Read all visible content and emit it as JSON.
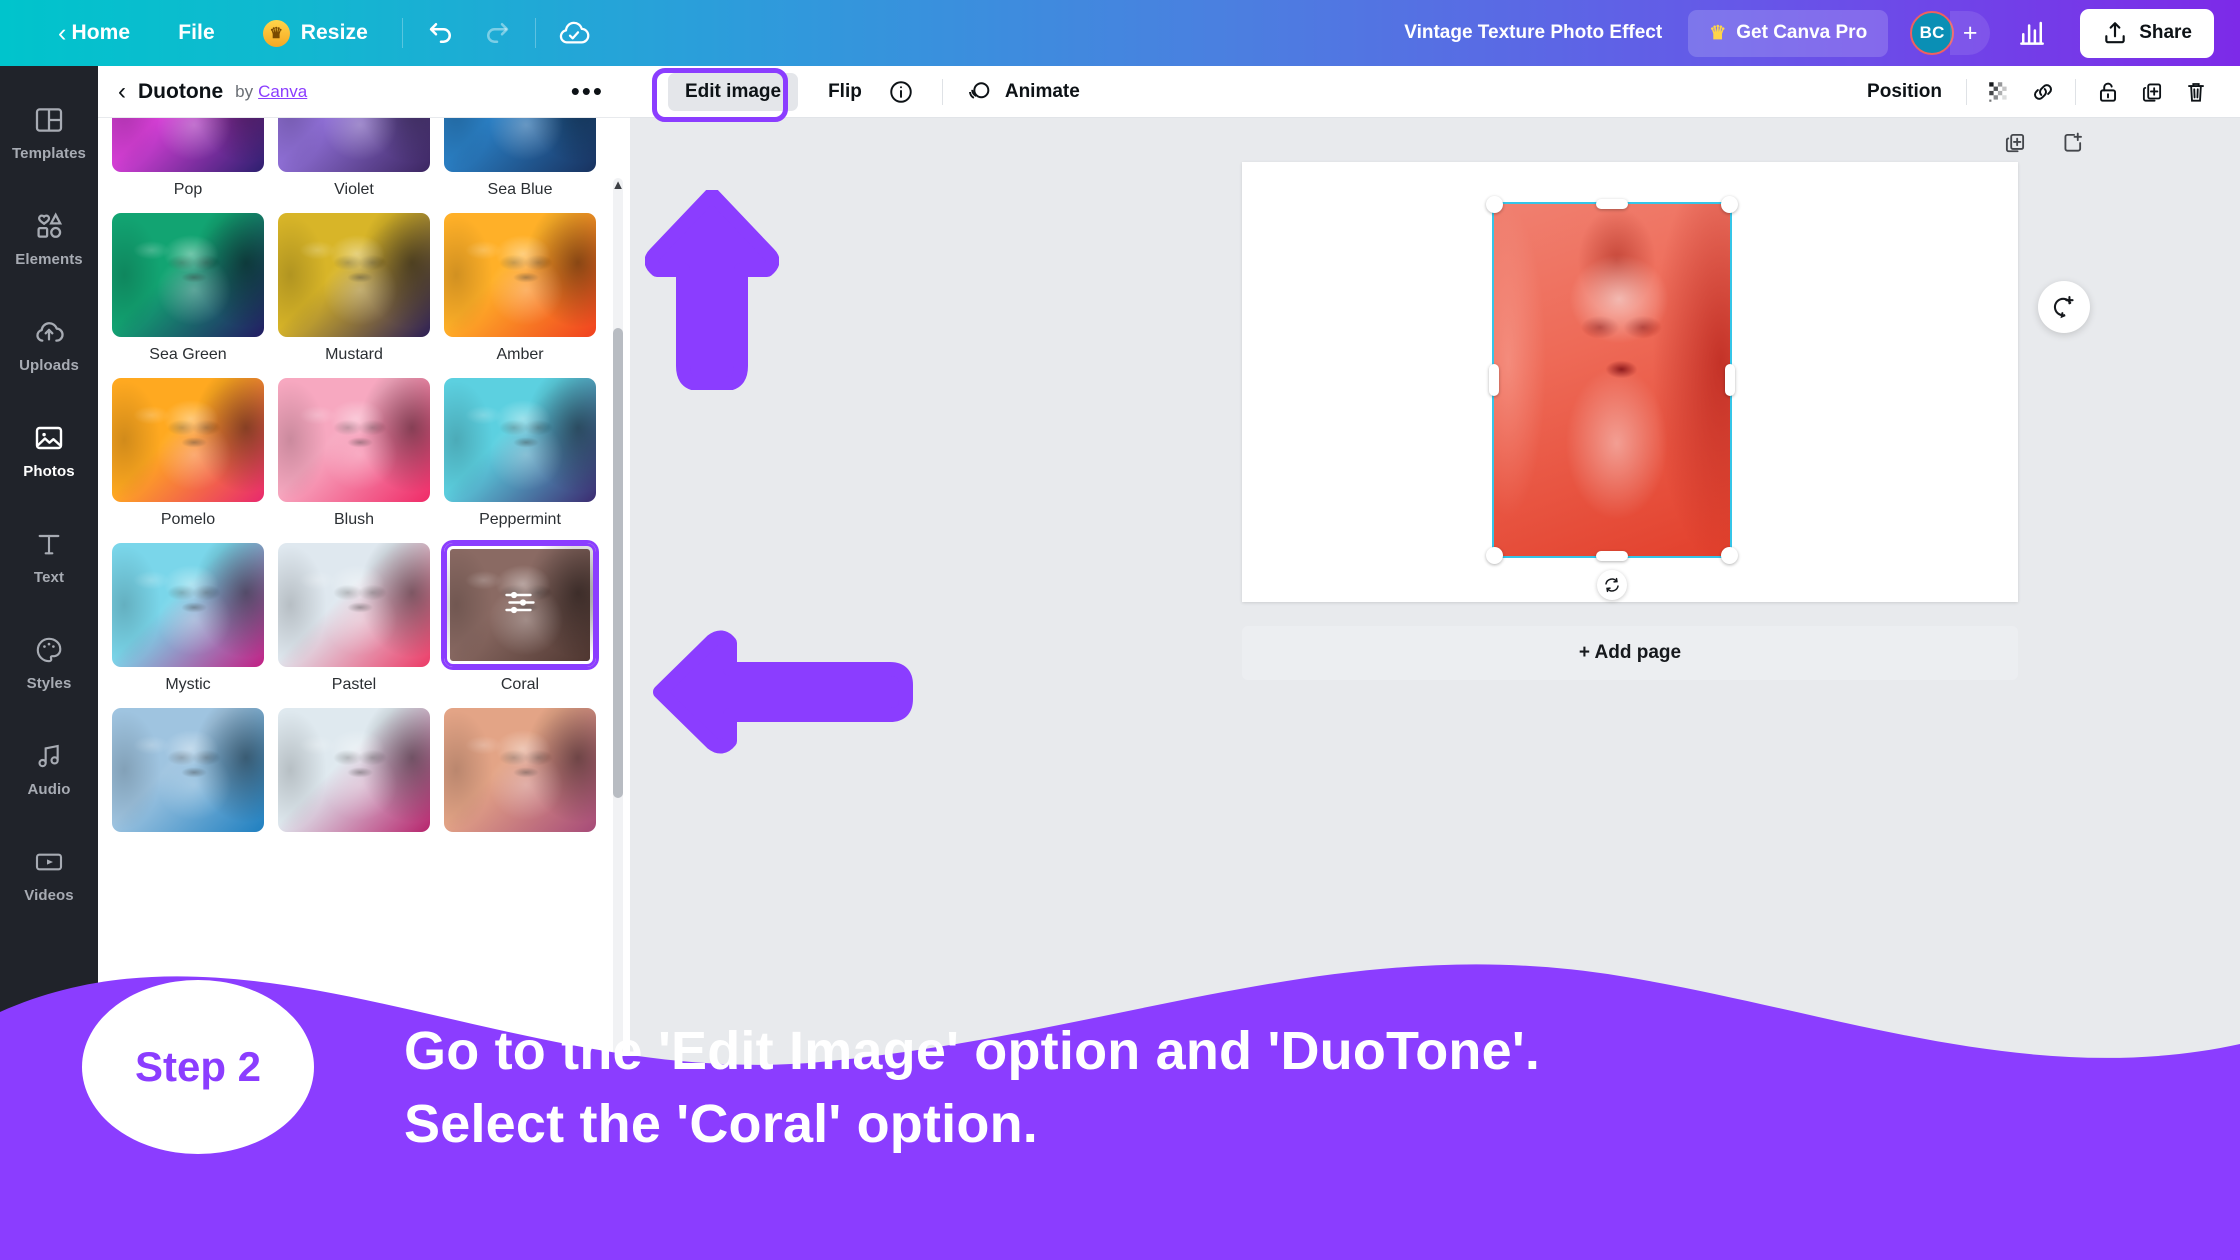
{
  "topbar": {
    "back_chevron": "‹",
    "home_label": "Home",
    "file_label": "File",
    "resize_label": "Resize",
    "crown_glyph": "♛",
    "undo_icon": "undo-icon",
    "redo_icon": "redo-icon",
    "cloud_icon": "cloud-saved-icon",
    "doc_title": "Vintage Texture Photo Effect",
    "pro_label": "Get Canva Pro",
    "avatar_initials": "BC",
    "plus_label": "+",
    "stats_icon": "insights-icon",
    "share_label": "Share"
  },
  "rail": {
    "items": [
      {
        "label": "Templates",
        "icon": "templates-icon",
        "active": false
      },
      {
        "label": "Elements",
        "icon": "elements-icon",
        "active": false
      },
      {
        "label": "Uploads",
        "icon": "uploads-icon",
        "active": false
      },
      {
        "label": "Photos",
        "icon": "photos-icon",
        "active": true
      },
      {
        "label": "Text",
        "icon": "text-icon",
        "active": false
      },
      {
        "label": "Styles",
        "icon": "styles-icon",
        "active": false
      },
      {
        "label": "Audio",
        "icon": "audio-icon",
        "active": false
      },
      {
        "label": "Videos",
        "icon": "videos-icon",
        "active": false
      }
    ]
  },
  "panel": {
    "back_chevron": "‹",
    "title": "Duotone",
    "by_label": "by",
    "author_link": "Canva",
    "more_dots": "•••",
    "filters": [
      {
        "label": "Pop",
        "light": "#d63fd6",
        "dark": "#2b1f6e",
        "selected": false,
        "cutoff": true
      },
      {
        "label": "Violet",
        "light": "#8f6fd6",
        "dark": "#3b2560",
        "selected": false,
        "cutoff": true
      },
      {
        "label": "Sea Blue",
        "light": "#2a7fc4",
        "dark": "#18315e",
        "selected": false,
        "cutoff": true
      },
      {
        "label": "Sea Green",
        "light": "#12a472",
        "dark": "#231b63",
        "selected": false,
        "cutoff": false
      },
      {
        "label": "Mustard",
        "light": "#d8b528",
        "dark": "#2b1d55",
        "selected": false,
        "cutoff": false
      },
      {
        "label": "Amber",
        "light": "#ffb028",
        "dark": "#f0401f",
        "selected": false,
        "cutoff": false
      },
      {
        "label": "Pomelo",
        "light": "#ffa920",
        "dark": "#e8286e",
        "selected": false,
        "cutoff": false
      },
      {
        "label": "Blush",
        "light": "#f7a8c0",
        "dark": "#ef2a67",
        "selected": false,
        "cutoff": false
      },
      {
        "label": "Peppermint",
        "light": "#5cd0e0",
        "dark": "#3b2a70",
        "selected": false,
        "cutoff": false
      },
      {
        "label": "Mystic",
        "light": "#7ad6ea",
        "dark": "#c21f84",
        "selected": false,
        "cutoff": false
      },
      {
        "label": "Pastel",
        "light": "#dfe8ef",
        "dark": "#ec3a66",
        "selected": false,
        "cutoff": false
      },
      {
        "label": "Coral",
        "light": "#8a6a63",
        "dark": "#4a322c",
        "selected": true,
        "cutoff": false
      },
      {
        "label": "",
        "light": "#9fc4e0",
        "dark": "#1e7fc0",
        "selected": false,
        "cutoff": false
      },
      {
        "label": "",
        "light": "#dfe9ef",
        "dark": "#b6246c",
        "selected": false,
        "cutoff": false
      },
      {
        "label": "",
        "light": "#e3a486",
        "dark": "#a64a78",
        "selected": false,
        "cutoff": false
      }
    ],
    "selected_filter": "Coral",
    "adjust_icon": "sliders-icon",
    "scroll_up_icon": "chevron-up-icon",
    "scroll_down_icon": "chevron-down-icon"
  },
  "workspace": {
    "toolbar": {
      "edit_image_label": "Edit image",
      "flip_label": "Flip",
      "info_icon": "info-icon",
      "animate_label": "Animate",
      "animate_icon": "animate-icon",
      "position_label": "Position",
      "transparency_icon": "transparency-icon",
      "link_icon": "link-icon",
      "lock_icon": "lock-icon",
      "duplicate_icon": "duplicate-icon",
      "delete_icon": "trash-icon"
    },
    "page_tools": {
      "duplicate_page_icon": "duplicate-page-icon",
      "add_page_icon": "add-page-icon"
    },
    "comment_icon": "add-comment-icon",
    "rotate_icon": "rotate-icon",
    "add_page_label": "+ Add page",
    "selection_color": "#35c5e8",
    "image_tint_light": "#f08070",
    "image_tint_dark": "#e2402c"
  },
  "banner": {
    "step_label": "Step 2",
    "line1": "Go to the 'Edit Image' option and 'DuoTone'.",
    "line2": "Select the 'Coral' option.",
    "color": "#8b3dff"
  },
  "annotations": {
    "arrow_up": "arrow-up-annotation",
    "arrow_left": "arrow-left-annotation",
    "highlight_ring": "edit-image-highlight-ring",
    "color": "#8b3dff"
  }
}
